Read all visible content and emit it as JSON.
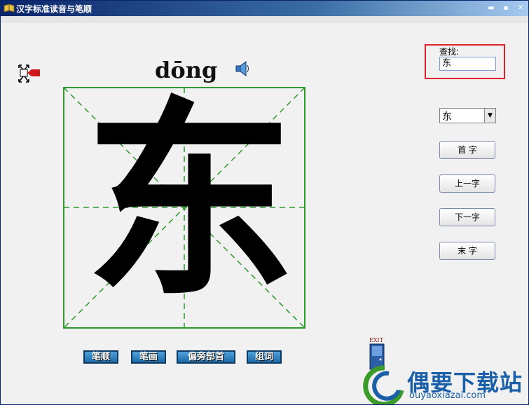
{
  "window": {
    "title": "汉字标准读音与笔顺",
    "min_label": "▬",
    "max_label": "▪",
    "close_label": "✕"
  },
  "main": {
    "pinyin": "dōng",
    "character": "东"
  },
  "search": {
    "label": "查找:",
    "value": "东"
  },
  "selector": {
    "value": "东",
    "arrow": "▼"
  },
  "nav": {
    "first": "首 字",
    "prev": "上一字",
    "next": "下一字",
    "last": "末 字"
  },
  "bottom_tabs": [
    "笔顺",
    "笔画",
    "偏旁部首",
    "组词"
  ],
  "exit": {
    "label": "EXIT"
  },
  "watermark": {
    "name": "偶要下载站",
    "url": "ouyaoxiazai.com"
  },
  "colors": {
    "title_bar": "#0a246a",
    "grid_border": "#2e9a2e",
    "grid_dash": "#2e9a2e",
    "search_highlight": "#e0202a",
    "tab_fill": "#1d6aa8",
    "watermark": "#1a5fa8"
  }
}
